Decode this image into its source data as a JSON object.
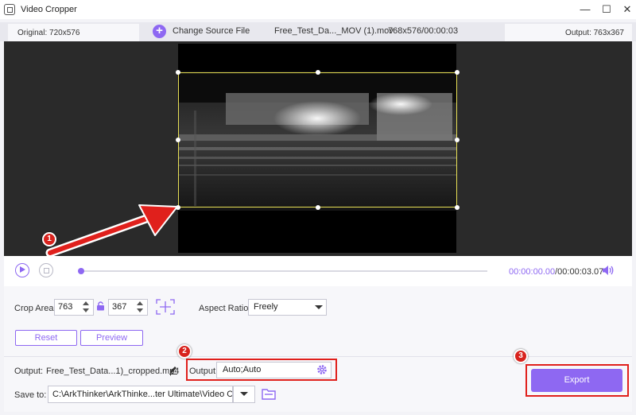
{
  "window": {
    "title": "Video Cropper",
    "controls": {
      "minimize": "—",
      "maximize": "☐",
      "close": "✕"
    }
  },
  "infobar": {
    "original": "Original: 720x576",
    "change_source": "Change Source File",
    "filename": "Free_Test_Da..._MOV (1).mov",
    "file_info": "768x576/00:00:03",
    "output": "Output: 763x367"
  },
  "player": {
    "current_time": "00:00:00.00",
    "total_time": "/00:00:03.07",
    "progress": 0
  },
  "crop": {
    "label": "Crop Area:",
    "width": "763",
    "height": "367",
    "aspect_label": "Aspect Ratio:",
    "aspect_value": "Freely",
    "reset_label": "Reset",
    "preview_label": "Preview"
  },
  "output": {
    "label": "Output:",
    "filename": "Free_Test_Data...1)_cropped.mp4",
    "settings_label": "Output:",
    "settings_value": "Auto;Auto",
    "save_label": "Save to:",
    "save_path": "C:\\ArkThinker\\ArkThinke...ter Ultimate\\Video Crop",
    "export_label": "Export"
  },
  "annotations": {
    "badge1": "1",
    "badge2": "2",
    "badge3": "3"
  },
  "colors": {
    "accent": "#8e68f2",
    "annotation": "#e0201c",
    "crop_frame": "#e8e055"
  },
  "icons": [
    "app-icon",
    "plus-icon",
    "play-icon",
    "stop-icon",
    "volume-icon",
    "lock-icon",
    "center-icon",
    "edit-icon",
    "gear-icon",
    "folder-icon",
    "chevron-down-icon"
  ]
}
